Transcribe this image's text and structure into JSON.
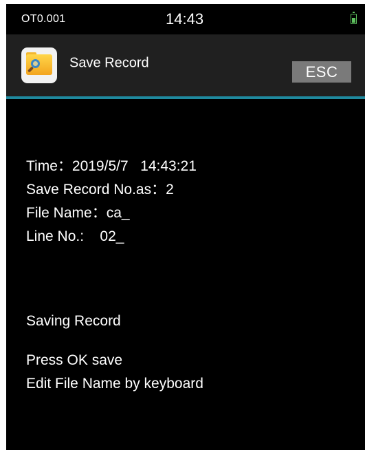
{
  "status_bar": {
    "left_text": "OT0.001",
    "time": "14:43",
    "battery_icon": "battery-icon",
    "battery_color": "#5ec15e"
  },
  "header": {
    "icon": "folder-search-icon",
    "title": "Save Record",
    "esc_label": "ESC",
    "accent_color": "#1f8a9f"
  },
  "record": {
    "time_label": "Time：",
    "time_value": "2019/5/7   14:43:21",
    "record_no_label": "Save Record No.as：",
    "record_no_value": "2",
    "file_name_label": "File Name：",
    "file_name_value": "ca_",
    "line_no_label": "Line No.:    ",
    "line_no_value": "02_"
  },
  "messages": {
    "status": "Saving Record",
    "instruction_ok": "Press OK save",
    "instruction_edit": "Edit File Name by keyboard"
  }
}
